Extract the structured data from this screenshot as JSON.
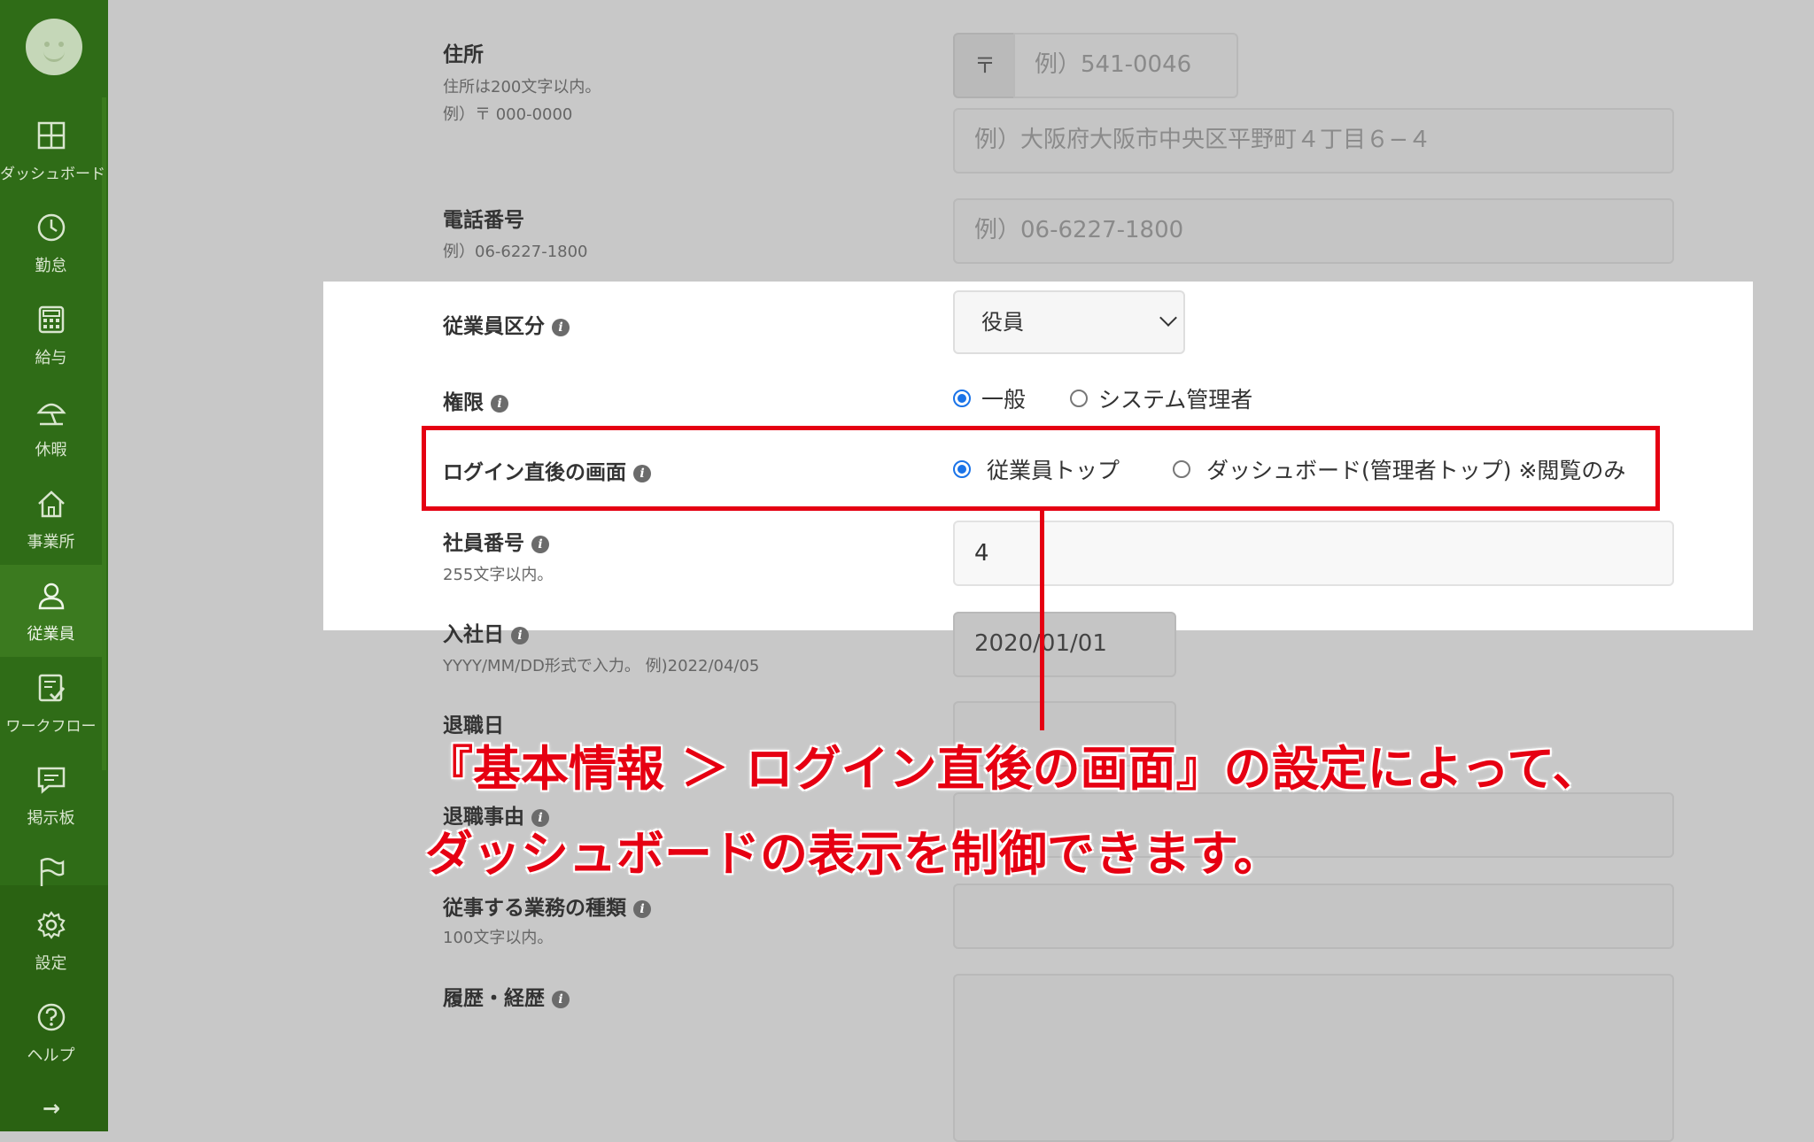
{
  "sidebar": {
    "items": [
      {
        "label": "ダッシュボード",
        "icon": "dashboard-icon"
      },
      {
        "label": "勤怠",
        "icon": "clock-icon"
      },
      {
        "label": "給与",
        "icon": "calculator-icon"
      },
      {
        "label": "休暇",
        "icon": "umbrella-icon"
      },
      {
        "label": "事業所",
        "icon": "home-icon"
      },
      {
        "label": "従業員",
        "icon": "person-icon",
        "active": true
      },
      {
        "label": "ワークフロー",
        "icon": "checklist-icon"
      },
      {
        "label": "掲示板",
        "icon": "chat-icon"
      },
      {
        "label": "",
        "icon": "flag-icon"
      },
      {
        "label": "設定",
        "icon": "gear-icon"
      },
      {
        "label": "ヘルプ",
        "icon": "help-icon"
      }
    ],
    "collapse_arrow": "→"
  },
  "form": {
    "address": {
      "label": "住所",
      "hint1": "住所は200文字以内。",
      "hint2": "例）〒 000-0000",
      "zip_mark": "〒",
      "zip_placeholder": "例）541-0046",
      "address_placeholder": "例）大阪府大阪市中央区平野町４丁目６−４"
    },
    "phone": {
      "label": "電話番号",
      "hint": "例）06-6227-1800",
      "placeholder": "例）06-6227-1800"
    },
    "employee_type": {
      "label": "従業員区分",
      "selected": "役員"
    },
    "permission": {
      "label": "権限",
      "options": [
        "一般",
        "システム管理者"
      ],
      "selected_index": 0
    },
    "login_screen": {
      "label": "ログイン直後の画面",
      "options": [
        "従業員トップ",
        "ダッシュボード(管理者トップ) ※閲覧のみ"
      ],
      "selected_index": 0
    },
    "employee_number": {
      "label": "社員番号",
      "hint": "255文字以内。",
      "value": "4"
    },
    "hire_date": {
      "label": "入社日",
      "hint": "YYYY/MM/DD形式で入力。 例)2022/04/05",
      "value": "2020/01/01"
    },
    "retire_date": {
      "label": "退職日"
    },
    "retire_reason": {
      "label": "退職事由"
    },
    "job_type": {
      "label": "従事する業務の種類",
      "hint": "100文字以内。"
    },
    "history": {
      "label": "履歴・経歴"
    }
  },
  "annotation": {
    "line1": "『基本情報 ＞ ログイン直後の画面』の設定によって、",
    "line2": "ダッシュボードの表示を制御できます。",
    "color": "#e60012"
  }
}
